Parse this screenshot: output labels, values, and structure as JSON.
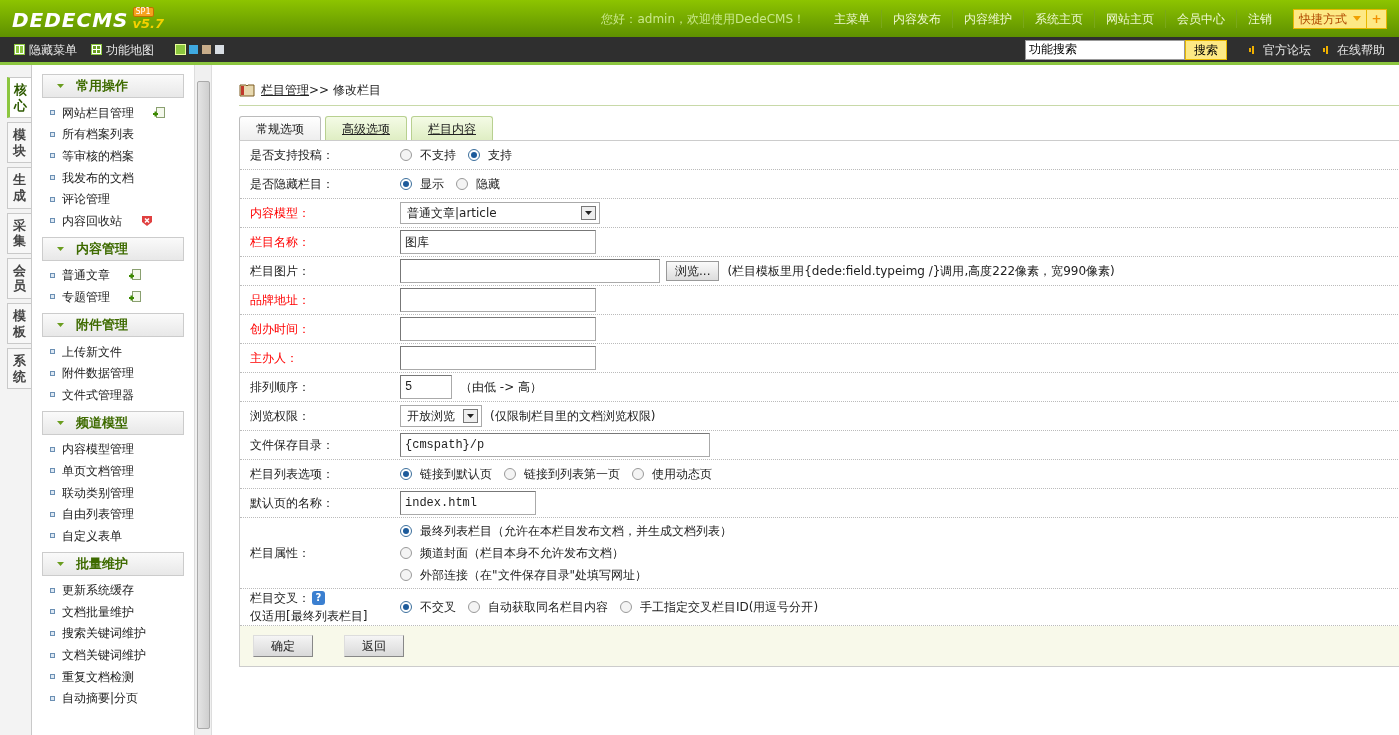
{
  "header": {
    "logo": "DEDECMS",
    "badge": "SP1",
    "version": "v5.7",
    "greeting": "您好：admin，欢迎使用DedeCMS！",
    "nav": [
      "主菜单",
      "内容发布",
      "内容维护",
      "系统主页",
      "网站主页",
      "会员中心",
      "注销"
    ],
    "quick": {
      "label": "快捷方式",
      "plus": "+"
    }
  },
  "toolbar": {
    "hide_menu": "隐藏菜单",
    "site_map": "功能地图",
    "skins": [
      {
        "color": "#8cc63f",
        "selected": true
      },
      {
        "color": "#3fa9e0",
        "selected": false
      },
      {
        "color": "#c8ad8a",
        "selected": false
      },
      {
        "color": "#d8dde3",
        "selected": false
      }
    ],
    "search": {
      "value": "功能搜索",
      "button": "搜索"
    },
    "links": [
      "官方论坛",
      "在线帮助"
    ]
  },
  "side_tabs": [
    {
      "label": "核心",
      "selected": true
    },
    {
      "label": "模块",
      "selected": false
    },
    {
      "label": "生成",
      "selected": false
    },
    {
      "label": "采集",
      "selected": false
    },
    {
      "label": "会员",
      "selected": false
    },
    {
      "label": "模板",
      "selected": false
    },
    {
      "label": "系统",
      "selected": false
    }
  ],
  "sidebar": [
    {
      "title": "常用操作",
      "items": [
        {
          "label": "网站栏目管理",
          "kind": "add"
        },
        {
          "label": "所有档案列表"
        },
        {
          "label": "等审核的档案"
        },
        {
          "label": "我发布的文档"
        },
        {
          "label": "评论管理"
        },
        {
          "label": "内容回收站",
          "kind": "delete"
        }
      ]
    },
    {
      "title": "内容管理",
      "items": [
        {
          "label": "普通文章",
          "kind": "add"
        },
        {
          "label": "专题管理",
          "kind": "add"
        }
      ]
    },
    {
      "title": "附件管理",
      "items": [
        {
          "label": "上传新文件"
        },
        {
          "label": "附件数据管理"
        },
        {
          "label": "文件式管理器"
        }
      ]
    },
    {
      "title": "频道模型",
      "items": [
        {
          "label": "内容模型管理"
        },
        {
          "label": "单页文档管理"
        },
        {
          "label": "联动类别管理"
        },
        {
          "label": "自由列表管理"
        },
        {
          "label": "自定义表单"
        }
      ]
    },
    {
      "title": "批量维护",
      "items": [
        {
          "label": "更新系统缓存"
        },
        {
          "label": "文档批量维护"
        },
        {
          "label": "搜索关键词维护"
        },
        {
          "label": "文档关键词维护"
        },
        {
          "label": "重复文档检测"
        },
        {
          "label": "自动摘要|分页"
        }
      ]
    }
  ],
  "breadcrumb": {
    "link": "栏目管理",
    "current": ">> 修改栏目"
  },
  "tabs": [
    {
      "label": "常规选项",
      "selected": true
    },
    {
      "label": "高级选项",
      "selected": false
    },
    {
      "label": "栏目内容",
      "selected": false
    }
  ],
  "form": [
    {
      "label": "是否支持投稿：",
      "required": false,
      "kind": "radio",
      "options": [
        {
          "label": "不支持",
          "selected": false
        },
        {
          "label": "支持",
          "selected": true
        }
      ]
    },
    {
      "label": "是否隐藏栏目：",
      "required": false,
      "kind": "radio",
      "options": [
        {
          "label": "显示",
          "selected": true
        },
        {
          "label": "隐藏",
          "selected": false
        }
      ]
    },
    {
      "label": "内容模型：",
      "required": true,
      "kind": "select",
      "value": "普通文章|article"
    },
    {
      "label": "栏目名称：",
      "required": true,
      "kind": "text",
      "value": "图库"
    },
    {
      "label": "栏目图片：",
      "required": false,
      "kind": "file",
      "button": "浏览...",
      "hint": "(栏目模板里用{dede:field.typeimg /}调用,高度222像素，宽990像素)"
    },
    {
      "label": "品牌地址：",
      "required": true,
      "kind": "text"
    },
    {
      "label": "创办时间：",
      "required": true,
      "kind": "text"
    },
    {
      "label": "主办人：",
      "required": true,
      "kind": "text"
    },
    {
      "label": "排列顺序：",
      "required": false,
      "kind": "number",
      "value": "5",
      "hint": "（由低 -> 高）"
    },
    {
      "label": "浏览权限：",
      "required": false,
      "kind": "compact-select",
      "value": "开放浏览",
      "hint": "(仅限制栏目里的文档浏览权限)"
    },
    {
      "label": "文件保存目录：",
      "required": false,
      "kind": "path",
      "value": "{cmspath}/p"
    },
    {
      "label": "栏目列表选项：",
      "required": false,
      "kind": "radio",
      "options": [
        {
          "label": "链接到默认页",
          "selected": true
        },
        {
          "label": "链接到列表第一页",
          "selected": false
        },
        {
          "label": "使用动态页",
          "selected": false
        }
      ]
    },
    {
      "label": "默认页的名称：",
      "required": false,
      "kind": "filename",
      "value": "index.html"
    },
    {
      "label": "栏目属性：",
      "required": false,
      "kind": "radio-stack",
      "options": [
        {
          "label": "最终列表栏目（允许在本栏目发布文档，并生成文档列表）",
          "selected": true
        },
        {
          "label": "频道封面（栏目本身不允许发布文档）",
          "selected": false
        },
        {
          "label": "外部连接（在\"文件保存目录\"处填写网址）",
          "selected": false
        }
      ]
    },
    {
      "label": "栏目交叉：",
      "required": false,
      "kind": "radio",
      "help": "?",
      "note": "仅适用[最终列表栏目]",
      "options": [
        {
          "label": "不交叉",
          "selected": true
        },
        {
          "label": "自动获取同名栏目内容",
          "selected": false
        },
        {
          "label": "手工指定交叉栏目ID(用逗号分开)",
          "selected": false
        }
      ]
    }
  ],
  "buttons": [
    "确定",
    "返回"
  ]
}
